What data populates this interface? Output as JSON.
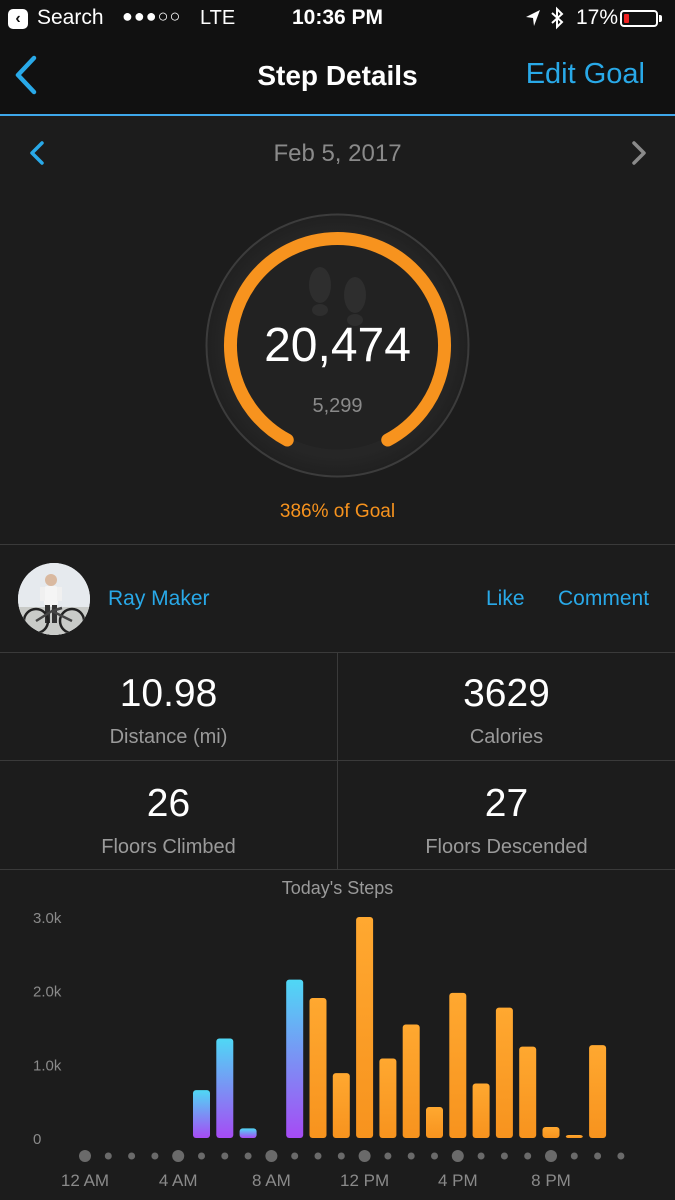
{
  "status_bar": {
    "back_app": "Search",
    "signal_dots": "●●●○○",
    "network": "LTE",
    "time": "10:36 PM",
    "battery_pct": "17%",
    "battery_level": 0.17
  },
  "nav": {
    "title": "Step Details",
    "edit_goal": "Edit Goal"
  },
  "date": {
    "label": "Feb 5, 2017"
  },
  "summary": {
    "steps": "20,474",
    "goal": "5,299",
    "goal_percent_text": "386% of Goal",
    "progress_fraction": 1.0,
    "ring_color": "#f7931e"
  },
  "user": {
    "name": "Ray Maker",
    "like": "Like",
    "comment": "Comment"
  },
  "stats": {
    "distance": {
      "value": "10.98",
      "label": "Distance (mi)"
    },
    "calories": {
      "value": "3629",
      "label": "Calories"
    },
    "floors_climbed": {
      "value": "26",
      "label": "Floors Climbed"
    },
    "floors_descended": {
      "value": "27",
      "label": "Floors Descended"
    }
  },
  "chart_data": {
    "type": "bar",
    "title": "Today's Steps",
    "ylim": [
      0,
      3000
    ],
    "y_ticks": [
      "0",
      "1.0k",
      "2.0k",
      "3.0k"
    ],
    "x_tick_labels": [
      "12 AM",
      "4 AM",
      "8 AM",
      "12 PM",
      "4 PM",
      "8 PM"
    ],
    "hours": [
      "12 AM",
      "1 AM",
      "2 AM",
      "3 AM",
      "4 AM",
      "5 AM",
      "6 AM",
      "7 AM",
      "8 AM",
      "9 AM",
      "10 AM",
      "11 AM",
      "12 PM",
      "1 PM",
      "2 PM",
      "3 PM",
      "4 PM",
      "5 PM",
      "6 PM",
      "7 PM",
      "8 PM",
      "9 PM",
      "10 PM",
      "11 PM"
    ],
    "values": [
      0,
      0,
      0,
      0,
      0,
      650,
      1350,
      130,
      0,
      2150,
      1900,
      880,
      3000,
      1080,
      1540,
      420,
      1970,
      740,
      1770,
      1240,
      150,
      40,
      1260,
      0
    ],
    "below_goal_color": [
      "#a64bf4",
      "#4fd8f5"
    ],
    "above_goal_color": [
      "#f7931e",
      "#ffa830"
    ],
    "first_goal_bar_index": 10,
    "grid": false
  }
}
